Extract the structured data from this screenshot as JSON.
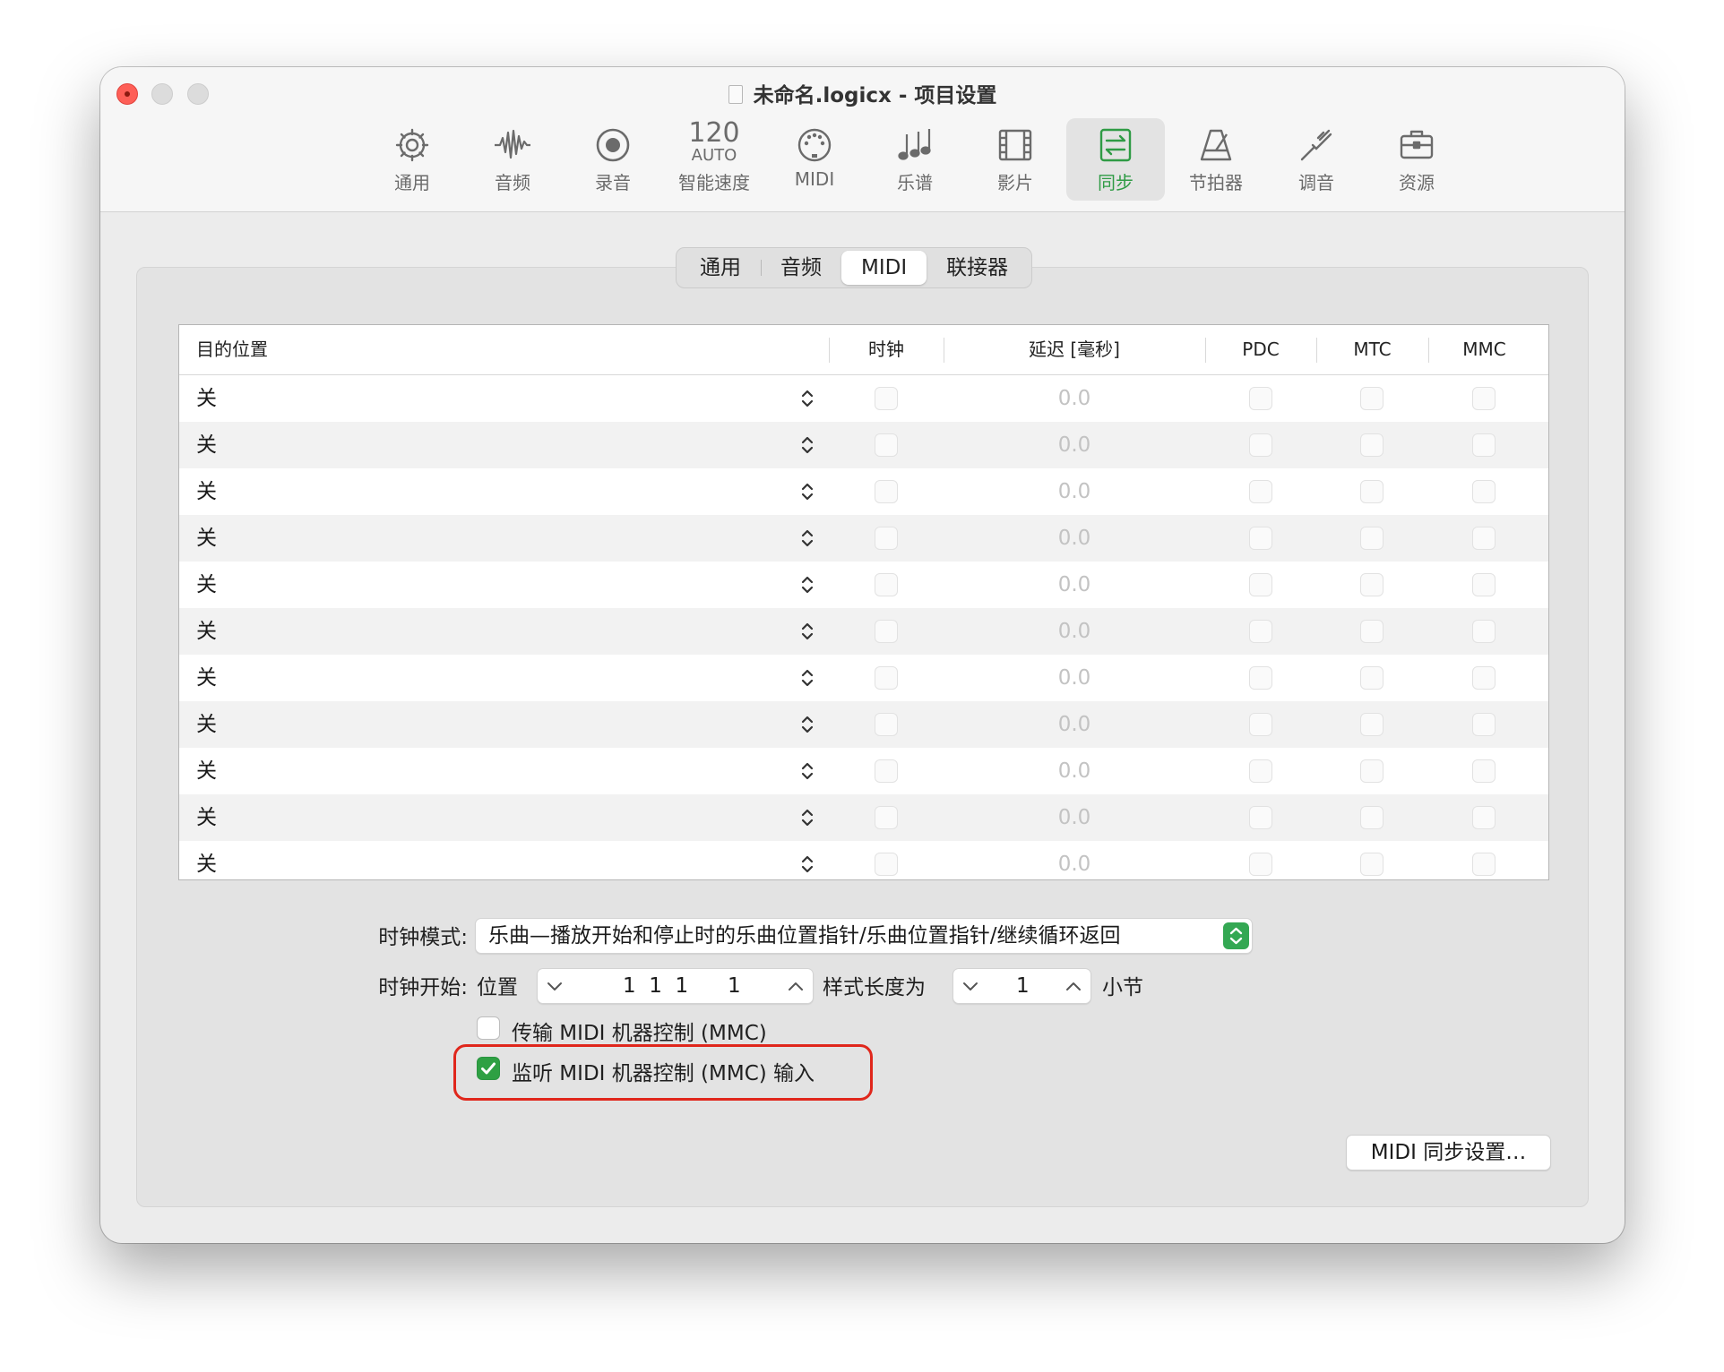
{
  "window": {
    "title": "未命名.logicx - 项目设置"
  },
  "toolbar": {
    "items": [
      {
        "label": "通用",
        "icon": "gear-icon"
      },
      {
        "label": "音频",
        "icon": "waveform-icon"
      },
      {
        "label": "录音",
        "icon": "record-icon"
      },
      {
        "label": "智能速度",
        "icon": "tempo-icon",
        "tempo_number": "120",
        "tempo_mode": "AUTO"
      },
      {
        "label": "MIDI",
        "icon": "midi-port-icon"
      },
      {
        "label": "乐谱",
        "icon": "notes-icon"
      },
      {
        "label": "影片",
        "icon": "film-icon"
      },
      {
        "label": "同步",
        "icon": "sync-icon",
        "active": true
      },
      {
        "label": "节拍器",
        "icon": "metronome-icon"
      },
      {
        "label": "调音",
        "icon": "tuning-fork-icon"
      },
      {
        "label": "资源",
        "icon": "briefcase-icon"
      }
    ],
    "active_color": "#2f9b45"
  },
  "subtabs": {
    "items": [
      "通用",
      "音频",
      "MIDI",
      "联接器"
    ],
    "selected": "MIDI"
  },
  "table": {
    "headers": {
      "destination": "目的位置",
      "clock": "时钟",
      "delay": "延迟 [毫秒]",
      "pdc": "PDC",
      "mtc": "MTC",
      "mmc": "MMC"
    },
    "rows": [
      {
        "destination": "关",
        "delay": "0.0"
      },
      {
        "destination": "关",
        "delay": "0.0"
      },
      {
        "destination": "关",
        "delay": "0.0"
      },
      {
        "destination": "关",
        "delay": "0.0"
      },
      {
        "destination": "关",
        "delay": "0.0"
      },
      {
        "destination": "关",
        "delay": "0.0"
      },
      {
        "destination": "关",
        "delay": "0.0"
      },
      {
        "destination": "关",
        "delay": "0.0"
      },
      {
        "destination": "关",
        "delay": "0.0"
      },
      {
        "destination": "关",
        "delay": "0.0"
      },
      {
        "destination": "关",
        "delay": "0.0"
      }
    ]
  },
  "clock_mode": {
    "label": "时钟模式:",
    "value": "乐曲—播放开始和停止时的乐曲位置指针/乐曲位置指针/继续循环返回"
  },
  "clock_start": {
    "label": "时钟开始:",
    "position_label": "位置",
    "position_value": "1  1  1      1",
    "pattern_label": "样式长度为",
    "pattern_value": "1",
    "unit": "小节"
  },
  "checkboxes": {
    "transmit_mmc": {
      "label": "传输 MIDI 机器控制 (MMC)",
      "checked": false
    },
    "listen_mmc": {
      "label": "监听 MIDI 机器控制 (MMC) 输入",
      "checked": true
    }
  },
  "midi_sync_button": "MIDI 同步设置…"
}
